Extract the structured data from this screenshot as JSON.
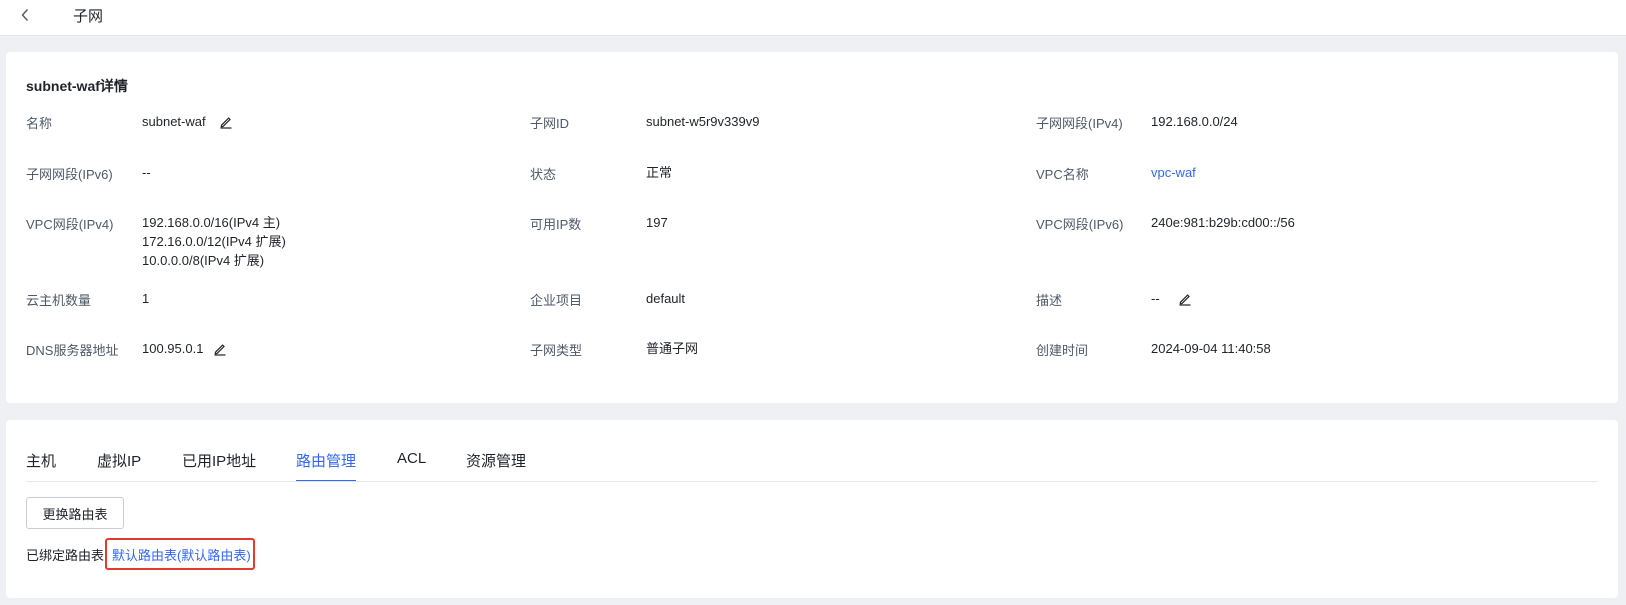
{
  "header": {
    "title": "子网"
  },
  "detail": {
    "title": "subnet-waf详情",
    "fields": {
      "name": {
        "label": "名称",
        "value": "subnet-waf"
      },
      "subnet_id": {
        "label": "子网ID",
        "value": "subnet-w5r9v339v9"
      },
      "ipv4_cidr": {
        "label": "子网网段(IPv4)",
        "value": "192.168.0.0/24"
      },
      "ipv6_cidr": {
        "label": "子网网段(IPv6)",
        "value": "--"
      },
      "status": {
        "label": "状态",
        "value": "正常"
      },
      "vpc_name": {
        "label": "VPC名称",
        "value": "vpc-waf"
      },
      "vpc_ipv4": {
        "label": "VPC网段(IPv4)",
        "values": [
          "192.168.0.0/16(IPv4 主)",
          "172.16.0.0/12(IPv4 扩展)",
          "10.0.0.0/8(IPv4 扩展)"
        ]
      },
      "available_ips": {
        "label": "可用IP数",
        "value": "197"
      },
      "vpc_ipv6": {
        "label": "VPC网段(IPv6)",
        "value": "240e:981:b29b:cd00::/56"
      },
      "vm_count": {
        "label": "云主机数量",
        "value": "1"
      },
      "enterprise_project": {
        "label": "企业项目",
        "value": "default"
      },
      "description": {
        "label": "描述",
        "value": "--"
      },
      "dns": {
        "label": "DNS服务器地址",
        "value": "100.95.0.1"
      },
      "subnet_type": {
        "label": "子网类型",
        "value": "普通子网"
      },
      "created_at": {
        "label": "创建时间",
        "value": "2024-09-04 11:40:58"
      }
    }
  },
  "tabs": {
    "items": [
      {
        "label": "主机"
      },
      {
        "label": "虚拟IP"
      },
      {
        "label": "已用IP地址"
      },
      {
        "label": "路由管理"
      },
      {
        "label": "ACL"
      },
      {
        "label": "资源管理"
      }
    ],
    "active_index": 3
  },
  "route": {
    "change_button": "更换路由表",
    "bound_label": "已绑定路由表",
    "bound_link": "默认路由表(默认路由表)"
  },
  "icons": {
    "back": "chevron-left-icon",
    "edit": "pencil-edit-icon"
  },
  "colors": {
    "accent": "#3366ff",
    "highlight_box": "#e23b2e"
  }
}
